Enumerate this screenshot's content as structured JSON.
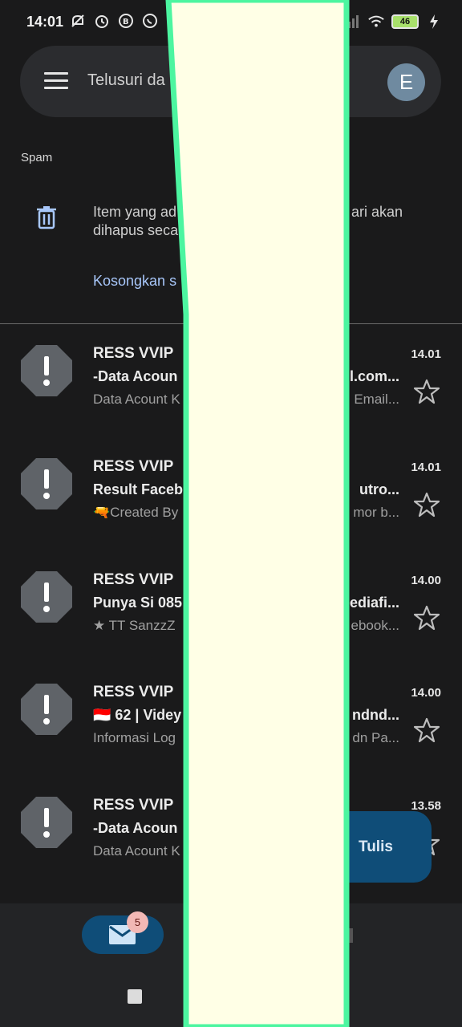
{
  "status_bar": {
    "time": "14:01",
    "battery": "46"
  },
  "search": {
    "placeholder": "Telusuri da",
    "avatar_initial": "E"
  },
  "folder": {
    "label": "Spam"
  },
  "info": {
    "text_line1": "Item yang ad",
    "text_line1_trail": "ari akan",
    "text_line2": "dihapus seca",
    "empty_link": "Kosongkan s"
  },
  "mails": [
    {
      "sender": "RESS VVIP",
      "subject": "-Data Acoun",
      "subject_trail": "l.com...",
      "preview": "Data Acount K",
      "preview_trail": "Email...",
      "time": "14.01"
    },
    {
      "sender": "RESS VVIP",
      "subject": "Result Faceb",
      "subject_trail": "utro...",
      "preview": "🔫Created By",
      "preview_trail": "mor b...",
      "time": "14.01"
    },
    {
      "sender": "RESS VVIP",
      "subject": "Punya Si 085",
      "subject_trail": "ediafi...",
      "preview": "★ TT SanzzZ",
      "preview_trail": "ebook...",
      "time": "14.00"
    },
    {
      "sender": "RESS VVIP",
      "subject": "🇮🇩 62 | Videy",
      "subject_trail": "ndnd...",
      "preview": "Informasi Log",
      "preview_trail": "dn Pa...",
      "time": "14.00"
    },
    {
      "sender": "RESS VVIP",
      "subject": "-Data Acoun",
      "subject_trail": "",
      "preview": "Data Acount K",
      "preview_trail": "",
      "time": "13.58"
    }
  ],
  "compose": {
    "label": "Tulis"
  },
  "bottom_nav": {
    "mail_badge": "5"
  },
  "colors": {
    "background": "#1a1a1b",
    "accent": "#0f4d78",
    "link": "#a8c7fa",
    "overlay_fill": "#ffffe6",
    "overlay_stroke": "#4cf5a0"
  }
}
